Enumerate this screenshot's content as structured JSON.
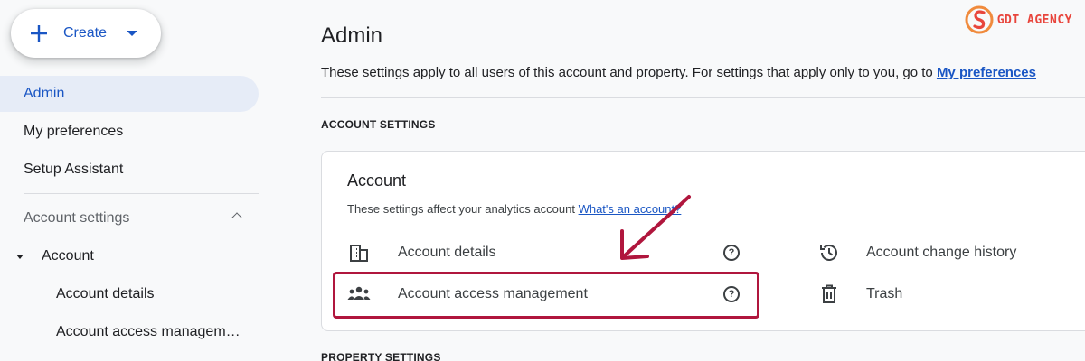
{
  "sidebar": {
    "create_label": "Create",
    "items": [
      {
        "label": "Admin"
      },
      {
        "label": "My preferences"
      },
      {
        "label": "Setup Assistant"
      },
      {
        "label": "Account settings"
      },
      {
        "label": "Account"
      },
      {
        "label": "Account details"
      },
      {
        "label": "Account access managem…"
      }
    ]
  },
  "main": {
    "title": "Admin",
    "desc_text": "These settings apply to all users of this account and property. For settings that apply only to you, go to ",
    "desc_link": "My preferences",
    "account_settings_label": "ACCOUNT SETTINGS",
    "property_settings_label": "PROPERTY SETTINGS",
    "card": {
      "title": "Account",
      "desc_text": "These settings affect your analytics account ",
      "desc_link": "What's an account?",
      "items": [
        {
          "label": "Account details",
          "icon": "building-icon"
        },
        {
          "label": "Account access management",
          "icon": "people-icon"
        },
        {
          "label": "Account change history",
          "icon": "history-icon"
        },
        {
          "label": "Trash",
          "icon": "trash-icon"
        }
      ],
      "help_glyph": "?"
    }
  },
  "logo": {
    "text": "GDT AGENCY"
  },
  "colors": {
    "accent": "#1a56c4",
    "highlight": "#b0163d",
    "active_bg": "#e6ecf7"
  }
}
